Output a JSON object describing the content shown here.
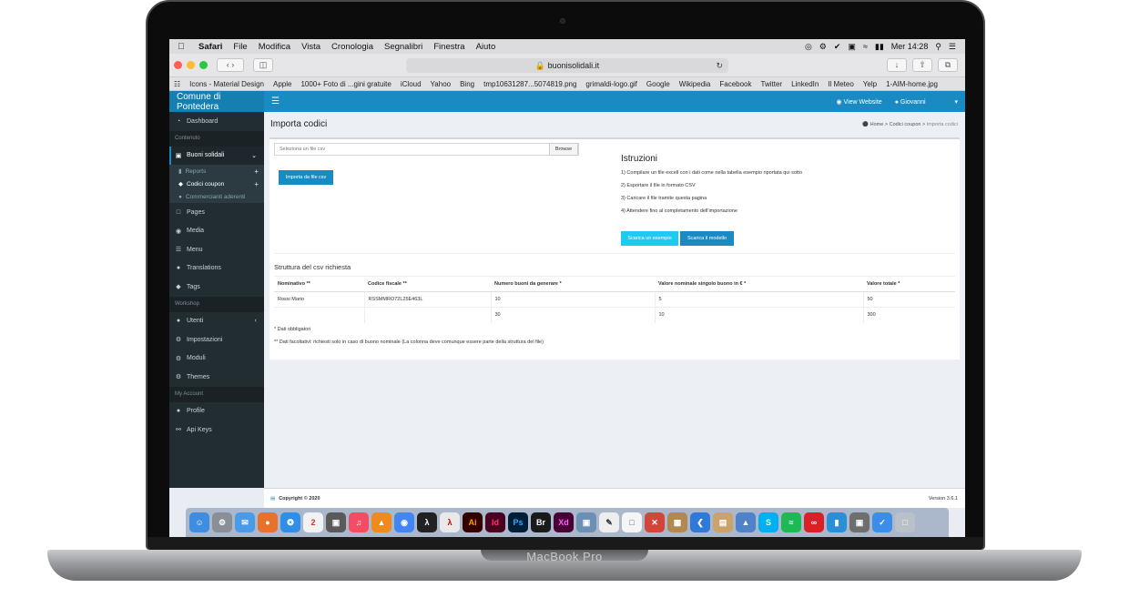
{
  "device_label": "MacBook Pro",
  "menubar": {
    "items": [
      "Safari",
      "File",
      "Modifica",
      "Vista",
      "Cronologia",
      "Segnalibri",
      "Finestra",
      "Aiuto"
    ],
    "clock": "Mer 14:28"
  },
  "browser": {
    "url": "buonisolidali.it",
    "bookmarks": [
      "Icons - Material Design",
      "Apple",
      "1000+ Foto di ...gini gratuite",
      "iCloud",
      "Yahoo",
      "Bing",
      "tmp10631287...5074819.png",
      "grimaldi-logo.gif",
      "Google",
      "Wikipedia",
      "Facebook",
      "Twitter",
      "LinkedIn",
      "Il Meteo",
      "Yelp",
      "1-AIM-home.jpg"
    ]
  },
  "app": {
    "brand": "Comune di Pontedera",
    "view_website": "View Website",
    "user": "Giovanni"
  },
  "sidebar": {
    "dashboard": "Dashboard",
    "h_contenuto": "Contenuto",
    "buoni": "Buoni solidali",
    "sub_reports": "Reports",
    "sub_codici": "Codici coupon",
    "sub_commercianti": "Commercianti aderenti",
    "pages": "Pages",
    "media": "Media",
    "menu": "Menu",
    "translations": "Translations",
    "tags": "Tags",
    "h_workshop": "Workshop",
    "utenti": "Utenti",
    "impostazioni": "Impostazioni",
    "moduli": "Moduli",
    "themes": "Themes",
    "h_account": "My Account",
    "profile": "Profile",
    "apikeys": "Api Keys"
  },
  "page": {
    "title": "Importa codici",
    "breadcrumb": [
      "Home",
      "Codici coupon",
      "Importa codici"
    ],
    "file_placeholder": "Seleziona un file csv",
    "browse": "Browse",
    "import_btn": "Importa da file csv",
    "istruzioni_title": "Istruzioni",
    "istruzioni": [
      "1) Compilare un file excell con i dati come nella tabella esempio riportata qui sotto",
      "2) Esportare il file in formato CSV",
      "3) Caricare il file tramite questa pagina",
      "4) Attendere fino al completamento dell'importazione"
    ],
    "btn_esempio": "Scarica un esempio",
    "btn_modello": "Scarica il modello",
    "csv_title": "Struttura del csv richiesta",
    "table": {
      "headers": [
        "Nominativo **",
        "Codice fiscale **",
        "Numero buoni da generare *",
        "Valore nominale singolo buono in € *",
        "Valore totale *"
      ],
      "rows": [
        [
          "Rossi Mario",
          "RSSMMRO72L25E463L",
          "10",
          "5",
          "50"
        ],
        [
          "",
          "",
          "30",
          "10",
          "300"
        ]
      ]
    },
    "note1": "* Dati obbligatori",
    "note2": "** Dati facoltativi: richiesti solo in caso di buono nominale (La colonna deve comunque essere parte della struttura del file)"
  },
  "footer": {
    "copyright": "Copyright © 2020",
    "version": "Version 3.6.1"
  },
  "dock": [
    "Finder",
    "Preferences",
    "Mail",
    "Firefox",
    "Safari",
    "Calendar",
    "Photos",
    "Music",
    "VLC",
    "Chrome",
    "Acrobat",
    "Acrobat",
    "Illustrator",
    "InDesign",
    "Photoshop",
    "Bridge",
    "XD",
    "Preview",
    "TextEdit",
    "Pages",
    "Tools",
    "Archive",
    "Notes",
    "Image",
    "Skype",
    "Spotify",
    "Creative Cloud",
    "Charts",
    "Screenshot",
    "Transmit",
    "Trash"
  ],
  "colors": {
    "primary": "#1a8bc2",
    "sidebar": "#222d32",
    "cyan": "#1ccbee"
  }
}
